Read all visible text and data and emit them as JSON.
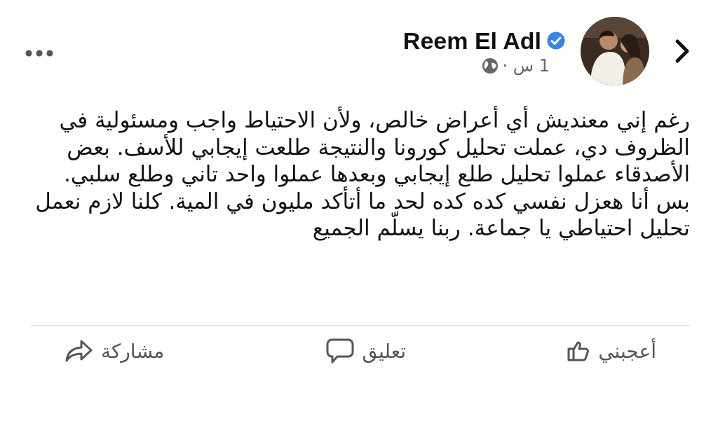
{
  "post": {
    "author": "Reem El Adl",
    "time": "1 س ·",
    "text": "رغم إني معنديش أي أعراض خالص، ولأن الاحتياط واجب ومسئولية في الظروف دي، عملت تحليل كورونا والنتيجة طلعت إيجابي للأسف. بعض الأصدقاء عملوا تحليل طلع إيجابي وبعدها عملوا واحد تاني وطلع سلبي. بس أنا هعزل نفسي كده كده لحد ما أتأكد مليون في المية. كلنا لازم نعمل تحليل احتياطي يا جماعة. ربنا يسلّم الجميع"
  },
  "actions": [
    {
      "kind": "like",
      "label": "أعجبني"
    },
    {
      "kind": "comment",
      "label": "تعليق"
    },
    {
      "kind": "share",
      "label": "مشاركة"
    }
  ]
}
